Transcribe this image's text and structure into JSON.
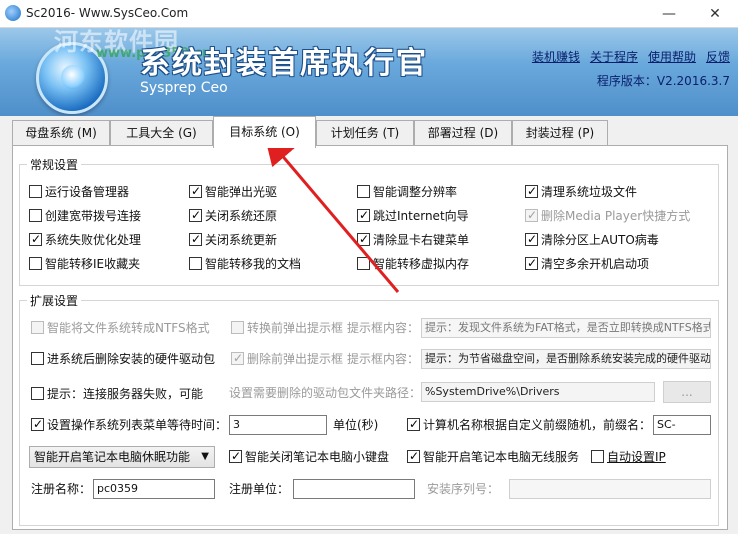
{
  "window": {
    "title": "Sc2016- Www.SysCeo.Com",
    "min": "—",
    "max": "☐",
    "close": "✕"
  },
  "header": {
    "watermark": "河东软件园",
    "watermark_url": "www.pc0359.cn",
    "product_title": "系统封装首席执行官",
    "product_subtitle": "Sysprep Ceo",
    "links": [
      "装机赚钱",
      "关于程序",
      "使用帮助",
      "反馈"
    ],
    "version": "程序版本：V2.2016.3.7"
  },
  "tabs": [
    {
      "label": "母盘系统 (M)",
      "active": false
    },
    {
      "label": "工具大全 (G)",
      "active": false
    },
    {
      "label": "目标系统 (O)",
      "active": true
    },
    {
      "label": "计划任务 (T)",
      "active": false
    },
    {
      "label": "部署过程 (D)",
      "active": false
    },
    {
      "label": "封装过程 (P)",
      "active": false
    }
  ],
  "general": {
    "title": "常规设置",
    "items": [
      {
        "label": "运行设备管理器",
        "checked": false,
        "disabled": false
      },
      {
        "label": "智能弹出光驱",
        "checked": true,
        "disabled": false
      },
      {
        "label": "智能调整分辨率",
        "checked": false,
        "disabled": false
      },
      {
        "label": "清理系统垃圾文件",
        "checked": true,
        "disabled": false
      },
      {
        "label": "创建宽带拨号连接",
        "checked": false,
        "disabled": false
      },
      {
        "label": "关闭系统还原",
        "checked": true,
        "disabled": false
      },
      {
        "label": "跳过Internet向导",
        "checked": true,
        "disabled": false
      },
      {
        "label": "删除Media Player快捷方式",
        "checked": true,
        "disabled": true
      },
      {
        "label": "系统失败优化处理",
        "checked": true,
        "disabled": false
      },
      {
        "label": "关闭系统更新",
        "checked": true,
        "disabled": false
      },
      {
        "label": "清除显卡右键菜单",
        "checked": true,
        "disabled": false
      },
      {
        "label": "清除分区上AUTO病毒",
        "checked": true,
        "disabled": false
      },
      {
        "label": "智能转移IE收藏夹",
        "checked": false,
        "disabled": false
      },
      {
        "label": "智能转移我的文档",
        "checked": false,
        "disabled": false
      },
      {
        "label": "智能转移虚拟内存",
        "checked": false,
        "disabled": false
      },
      {
        "label": "清空多余开机启动项",
        "checked": true,
        "disabled": false
      }
    ]
  },
  "extended": {
    "title": "扩展设置",
    "ntfs_check": "智能将文件系统转成NTFS格式",
    "prompt1_check": "转换前弹出提示框",
    "prompt_content_label": "提示框内容：",
    "prompt1_value": "提示：发现文件系统为FAT格式，是否立即转换成NTFS格式？",
    "delete_driver_check": "进系统后删除安装的硬件驱动包",
    "prompt2_check": "删除前弹出提示框",
    "prompt2_value": "提示：为节省磁盘空间，是否删除系统安装完成的硬件驱动包？",
    "server_fail_check": "提示：连接服务器失败，可能",
    "driver_path_label": "设置需要删除的驱动包文件夹路径：",
    "driver_path_value": "%SystemDrive%\\Drivers",
    "browse_btn": "...",
    "wait_time_check": "设置操作系统列表菜单等待时间：",
    "wait_time_value": "3",
    "unit_label": "单位(秒)",
    "computer_name_check": "计算机名称根据自定义前缀随机，前缀名：",
    "computer_name_prefix": "SC-",
    "sleep_select": "智能开启笔记本电脑休眠功能",
    "keyboard_check": "智能关闭笔记本电脑小键盘",
    "wireless_check": "智能开启笔记本电脑无线服务",
    "autoip_check": "自动设置IP",
    "reg_name_label": "注册名称：",
    "reg_name_value": "pc0359",
    "reg_unit_label": "注册单位：",
    "reg_unit_value": "",
    "serial_label": "安装序列号：",
    "serial_value": ""
  },
  "colors": {
    "banner": "#6aa9dc",
    "link": "#0a1f6b",
    "annotation_arrow": "#e02020"
  }
}
